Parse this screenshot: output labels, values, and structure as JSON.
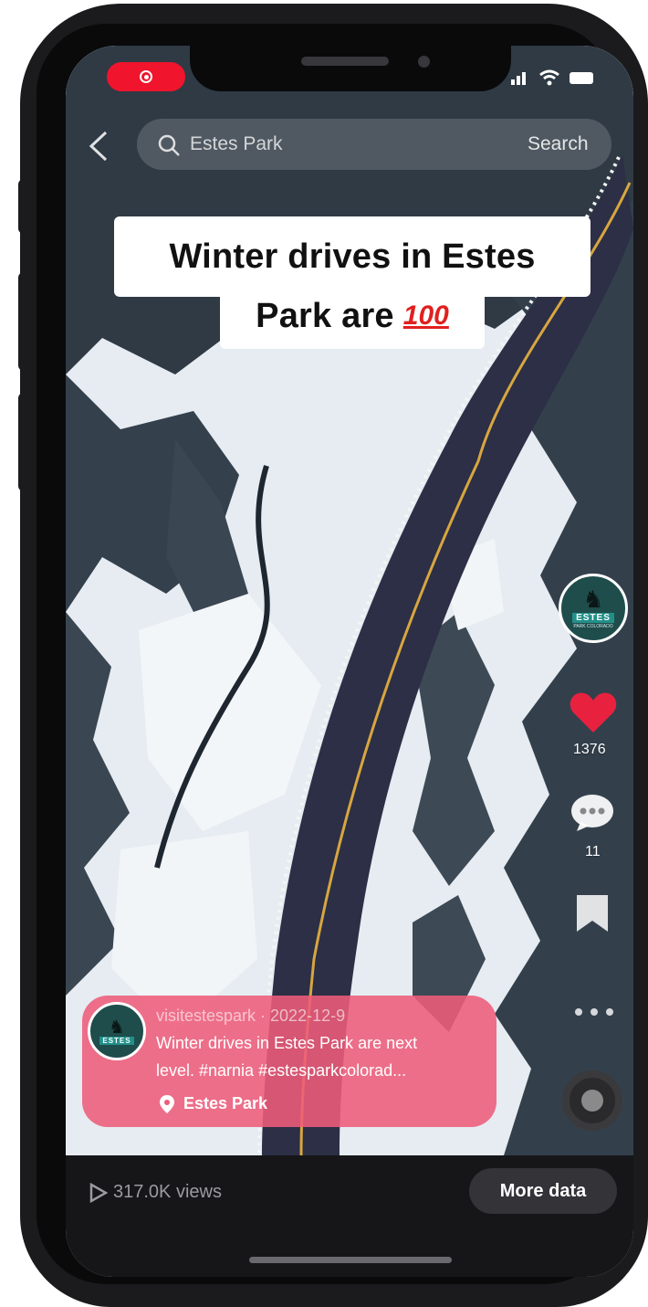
{
  "search": {
    "query": "Estes Park",
    "button": "Search"
  },
  "caption": {
    "line1": "Winter drives in Estes",
    "line2": "Park are",
    "emoji": "100"
  },
  "rail": {
    "avatar_brand": "ESTES",
    "avatar_sub": "PARK COLORADO",
    "likes": "1376",
    "comments": "11"
  },
  "post": {
    "meta": "visitestespark · 2022-12-9",
    "text_line1": "Winter drives in Estes Park are next",
    "text_line2": "level. #narnia #estesparkcolorad...",
    "location": "Estes Park"
  },
  "footer": {
    "views": "317.0K views",
    "more_button": "More data"
  },
  "colors": {
    "record": "#f0142c",
    "like": "#e8213f",
    "card": "#ee5c7a",
    "avatar_teal": "#22908a"
  }
}
